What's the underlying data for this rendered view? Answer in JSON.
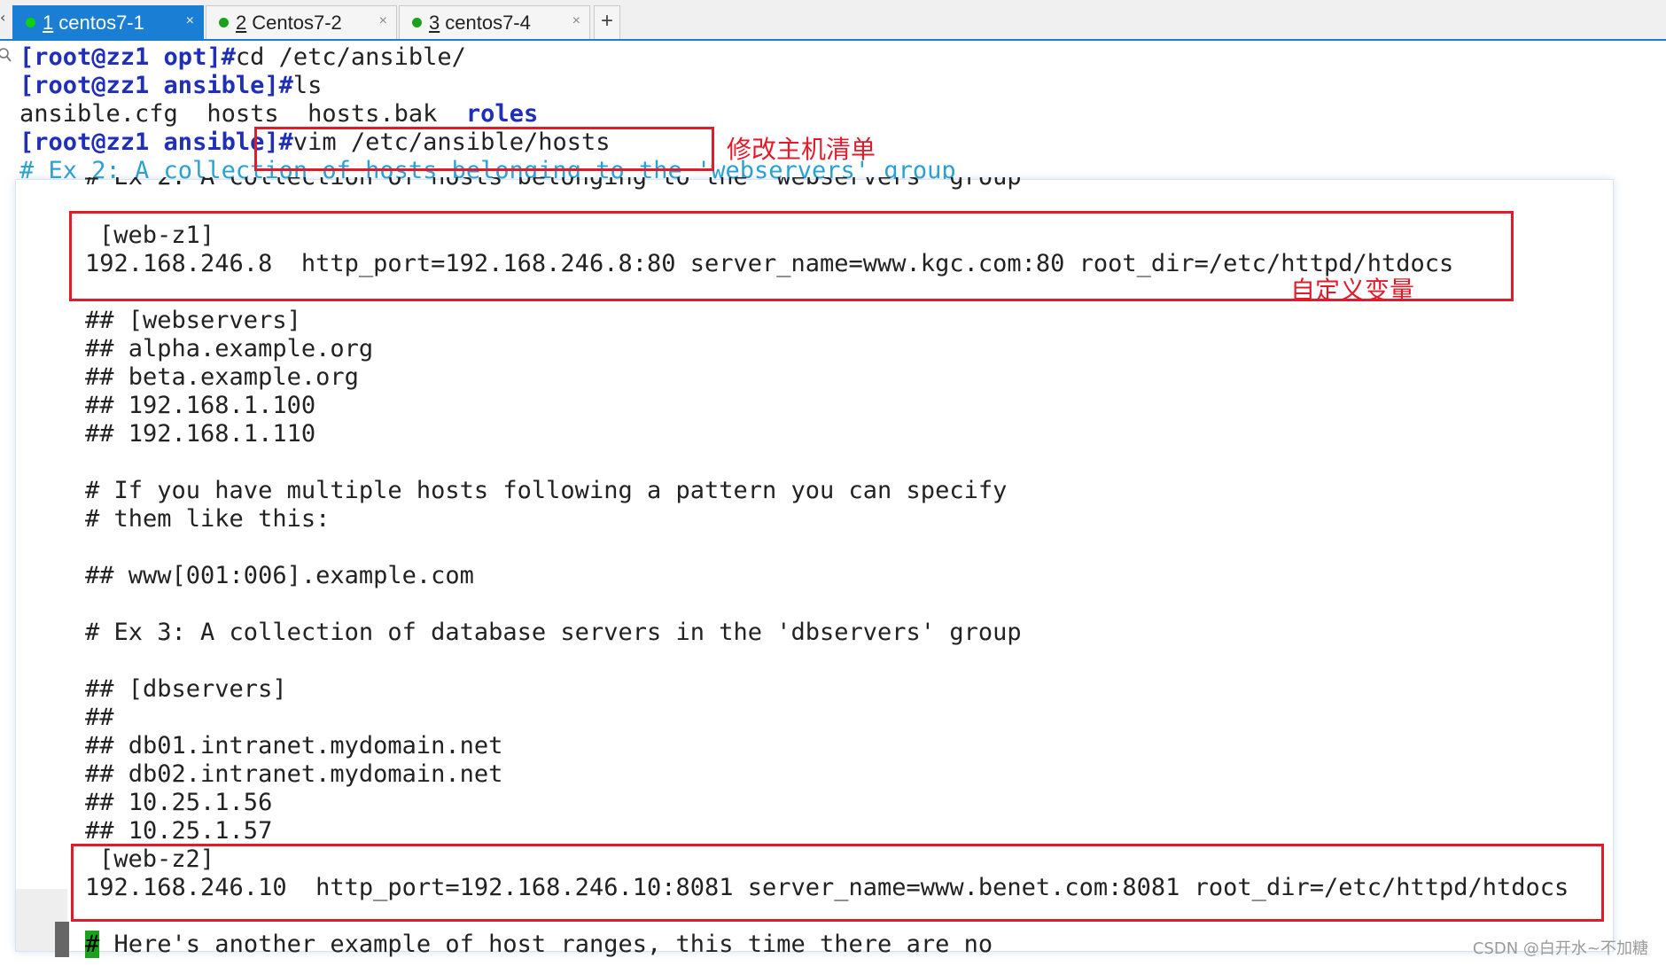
{
  "tabs": [
    {
      "num": "1",
      "label": "centos7-1",
      "active": true
    },
    {
      "num": "2",
      "label": "Centos7-2",
      "active": false
    },
    {
      "num": "3",
      "label": "centos7-4",
      "active": false
    }
  ],
  "tab_add": "+",
  "tab_close": "×",
  "terminal": {
    "line1": {
      "prompt": "[root@zz1 opt]#",
      "cmd": "cd /etc/ansible/"
    },
    "line2": {
      "prompt": "[root@zz1 ansible]#",
      "cmd": "ls"
    },
    "line3": {
      "files": "ansible.cfg  hosts  hosts.bak  ",
      "dir": "roles"
    },
    "line4": {
      "prompt": "[root@zz1 ansible]#",
      "cmd": "vim /etc/ansible/hosts"
    },
    "line5": "# Ex 2: A collection of hosts belonging to the 'webservers' group"
  },
  "vim": {
    "header_echo": "# Ex 2: A collection of hosts belonging to the 'webservers' group",
    "group1": "[web-z1]",
    "host1": "192.168.246.8  http_port=192.168.246.8:80 server_name=www.kgc.com:80 root_dir=/etc/httpd/htdocs",
    "c1": "## [webservers]",
    "c2": "## alpha.example.org",
    "c3": "## beta.example.org",
    "c4": "## 192.168.1.100",
    "c5": "## 192.168.1.110",
    "c6": "# If you have multiple hosts following a pattern you can specify",
    "c7": "# them like this:",
    "c8": "## www[001:006].example.com",
    "c9": "# Ex 3: A collection of database servers in the 'dbservers' group",
    "c10": "## [dbservers]",
    "c11": "##",
    "c12": "## db01.intranet.mydomain.net",
    "c13": "## db02.intranet.mydomain.net",
    "c14": "## 10.25.1.56",
    "c15": "## 10.25.1.57",
    "group2": "[web-z2]",
    "host2": "192.168.246.10  http_port=192.168.246.10:8081 server_name=www.benet.com:8081 root_dir=/etc/httpd/htdocs",
    "last_cursor": "#",
    "last_rest": " Here's another example of host ranges, this time there are no"
  },
  "annotations": {
    "edit_inventory": "修改主机清单",
    "custom_vars": "自定义变量"
  },
  "watermark": "CSDN @白开水~不加糖",
  "colors": {
    "tab_active": "#1a7fd4",
    "prompt": "#1f2fb8",
    "comment": "#2aa1d6",
    "annotation": "#e21b2b",
    "cursor": "#1aa31a"
  }
}
